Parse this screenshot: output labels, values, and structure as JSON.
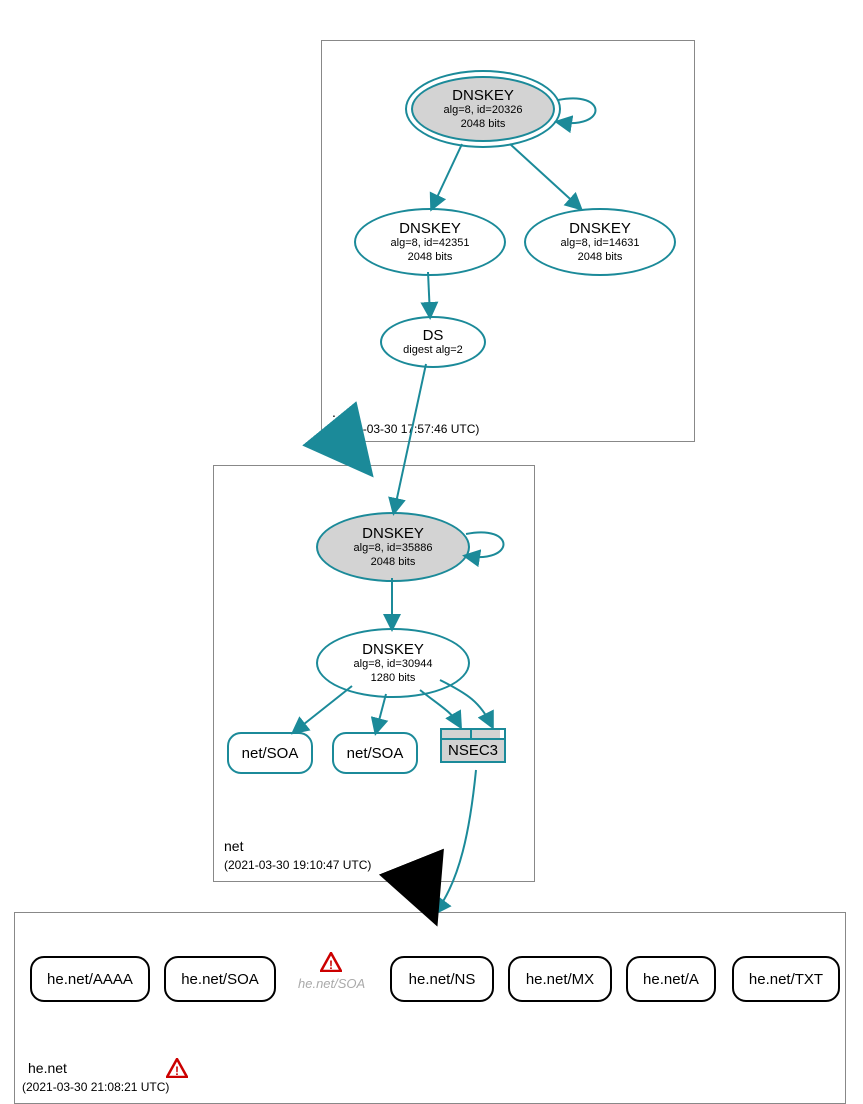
{
  "zones": {
    "root": {
      "label": ".",
      "timestamp": "(2021-03-30 17:57:46 UTC)",
      "ksk": {
        "title": "DNSKEY",
        "line1": "alg=8, id=20326",
        "line2": "2048 bits"
      },
      "zsk1": {
        "title": "DNSKEY",
        "line1": "alg=8, id=42351",
        "line2": "2048 bits"
      },
      "zsk2": {
        "title": "DNSKEY",
        "line1": "alg=8, id=14631",
        "line2": "2048 bits"
      },
      "ds": {
        "title": "DS",
        "line1": "digest alg=2"
      }
    },
    "net": {
      "label": "net",
      "timestamp": "(2021-03-30 19:10:47 UTC)",
      "ksk": {
        "title": "DNSKEY",
        "line1": "alg=8, id=35886",
        "line2": "2048 bits"
      },
      "zsk": {
        "title": "DNSKEY",
        "line1": "alg=8, id=30944",
        "line2": "1280 bits"
      },
      "rr1": "net/SOA",
      "rr2": "net/SOA",
      "nsec3": "NSEC3"
    },
    "henet": {
      "label": "he.net",
      "timestamp": "(2021-03-30 21:08:21 UTC)",
      "soa_faded": "he.net/SOA",
      "records": [
        "he.net/AAAA",
        "he.net/SOA",
        "he.net/NS",
        "he.net/MX",
        "he.net/A",
        "he.net/TXT"
      ]
    }
  },
  "colors": {
    "teal": "#1b8a99",
    "gray": "#d3d3d3"
  }
}
